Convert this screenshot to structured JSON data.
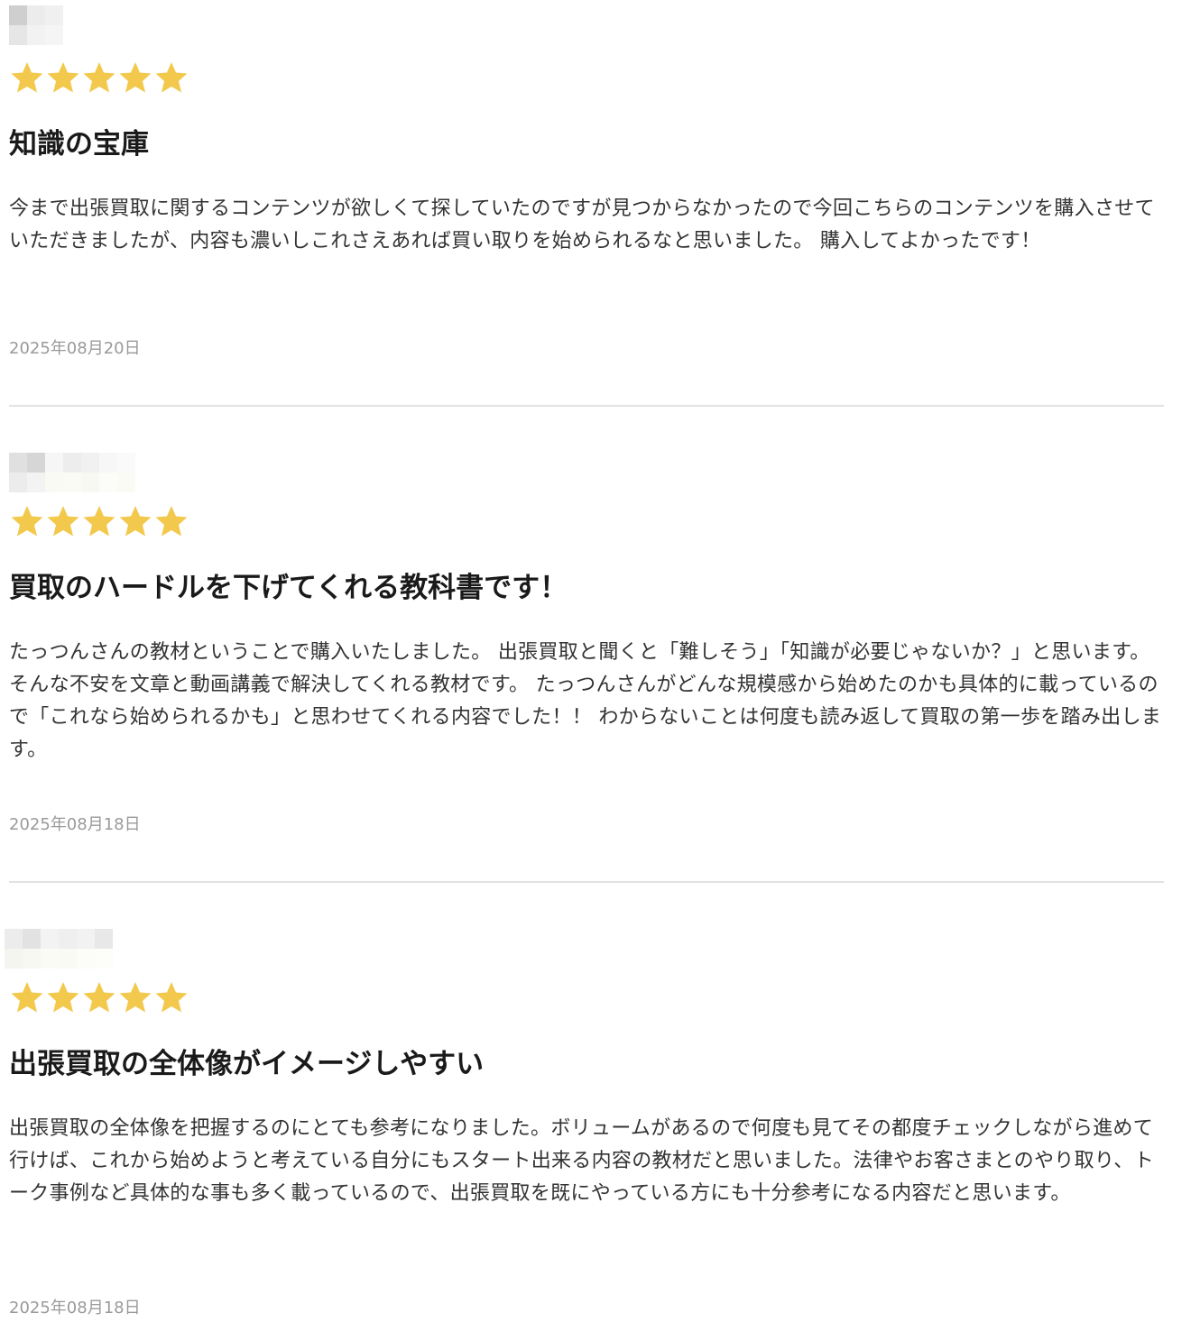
{
  "colors": {
    "star": "#F2C94C",
    "divider": "#E2E2E2",
    "date": "#9A9A9A",
    "title": "#1A1A1A",
    "body": "#333333"
  },
  "reviews": [
    {
      "avatar_icon": "blurred-avatar-icon",
      "rating": 5,
      "rating_max": 5,
      "title": "知識の宝庫",
      "body": "今まで出張買取に関するコンテンツが欲しくて探していたのですが見つからなかったので今回こちらのコンテンツを購入させていただきましたが、内容も濃いしこれさえあれば買い取りを始められるなと思いました。 購入してよかったです！",
      "date": "2025年08月20日"
    },
    {
      "avatar_icon": "blurred-avatar-icon",
      "rating": 5,
      "rating_max": 5,
      "title": "買取のハードルを下げてくれる教科書です！",
      "body": "たっつんさんの教材ということで購入いたしました。 出張買取と聞くと「難しそう」「知識が必要じゃないか？」と思います。 そんな不安を文章と動画講義で解決してくれる教材です。 たっつんさんがどんな規模感から始めたのかも具体的に載っているので「これなら始められるかも」と思わせてくれる内容でした！！ わからないことは何度も読み返して買取の第一歩を踏み出します。",
      "date": "2025年08月18日"
    },
    {
      "avatar_icon": "blurred-avatar-icon",
      "rating": 5,
      "rating_max": 5,
      "title": "出張買取の全体像がイメージしやすい",
      "body": "出張買取の全体像を把握するのにとても参考になりました。ボリュームがあるので何度も見てその都度チェックしながら進めて行けば、これから始めようと考えている自分にもスタート出来る内容の教材だと思いました。法律やお客さまとのやり取り、トーク事例など具体的な事も多く載っているので、出張買取を既にやっている方にも十分参考になる内容だと思います。",
      "date": "2025年08月18日"
    }
  ]
}
